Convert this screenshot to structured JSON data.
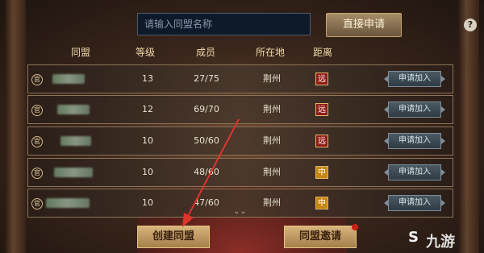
{
  "search": {
    "placeholder": "请输入同盟名称"
  },
  "apply_direct_label": "直接申请",
  "help_label": "?",
  "headers": {
    "alliance": "同盟",
    "level": "等级",
    "members": "成员",
    "location": "所在地",
    "distance": "距离"
  },
  "rank_glyph": "官",
  "join_label": "申请加入",
  "rows": [
    {
      "level": "13",
      "members": "27/75",
      "location": "荆州",
      "distance": "远",
      "distance_type": "far"
    },
    {
      "level": "12",
      "members": "69/70",
      "location": "荆州",
      "distance": "远",
      "distance_type": "far"
    },
    {
      "level": "10",
      "members": "50/60",
      "location": "荆州",
      "distance": "远",
      "distance_type": "far"
    },
    {
      "level": "10",
      "members": "48/60",
      "location": "荆州",
      "distance": "中",
      "distance_type": "mid"
    },
    {
      "level": "10",
      "members": "47/60",
      "location": "荆州",
      "distance": "中",
      "distance_type": "mid"
    }
  ],
  "scroll_indicator": "⌄⌄",
  "create_alliance_label": "创建同盟",
  "alliance_invite_label": "同盟邀请",
  "watermark": "九游",
  "colors": {
    "far": "#8e1b16",
    "mid": "#c48612",
    "arrow": "#e0332a"
  }
}
